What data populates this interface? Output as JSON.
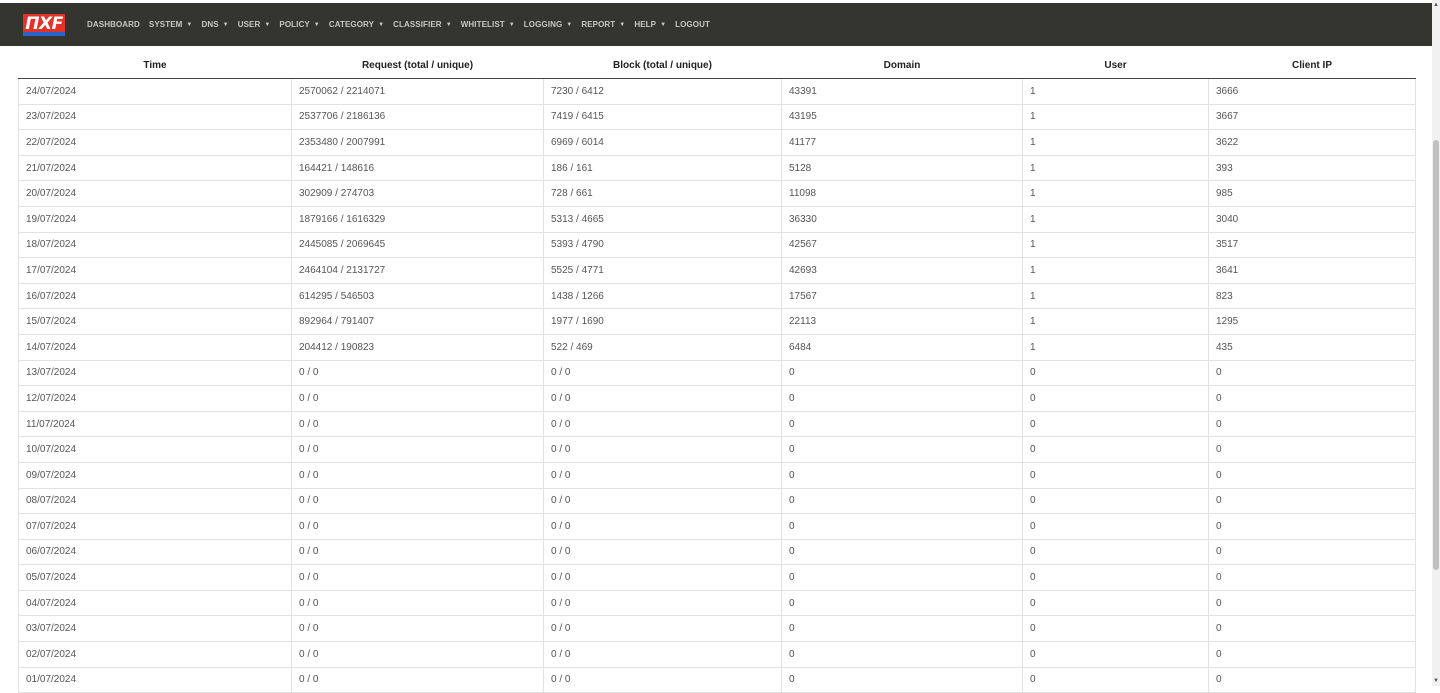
{
  "logo": "ΠXF",
  "nav": [
    {
      "label": "DASHBOARD",
      "caret": false
    },
    {
      "label": "SYSTEM",
      "caret": true
    },
    {
      "label": "DNS",
      "caret": true
    },
    {
      "label": "USER",
      "caret": true
    },
    {
      "label": "POLICY",
      "caret": true
    },
    {
      "label": "CATEGORY",
      "caret": true
    },
    {
      "label": "CLASSIFIER",
      "caret": true
    },
    {
      "label": "WHITELIST",
      "caret": true
    },
    {
      "label": "LOGGING",
      "caret": true
    },
    {
      "label": "REPORT",
      "caret": true
    },
    {
      "label": "HELP",
      "caret": true
    },
    {
      "label": "LOGOUT",
      "caret": false
    }
  ],
  "table": {
    "headers": [
      "Time",
      "Request (total / unique)",
      "Block (total / unique)",
      "Domain",
      "User",
      "Client IP"
    ],
    "rows": [
      [
        "24/07/2024",
        "2570062 / 2214071",
        "7230 / 6412",
        "43391",
        "1",
        "3666"
      ],
      [
        "23/07/2024",
        "2537706 / 2186136",
        "7419 / 6415",
        "43195",
        "1",
        "3667"
      ],
      [
        "22/07/2024",
        "2353480 / 2007991",
        "6969 / 6014",
        "41177",
        "1",
        "3622"
      ],
      [
        "21/07/2024",
        "164421 / 148616",
        "186 / 161",
        "5128",
        "1",
        "393"
      ],
      [
        "20/07/2024",
        "302909 / 274703",
        "728 / 661",
        "11098",
        "1",
        "985"
      ],
      [
        "19/07/2024",
        "1879166 / 1616329",
        "5313 / 4665",
        "36330",
        "1",
        "3040"
      ],
      [
        "18/07/2024",
        "2445085 / 2069645",
        "5393 / 4790",
        "42567",
        "1",
        "3517"
      ],
      [
        "17/07/2024",
        "2464104 / 2131727",
        "5525 / 4771",
        "42693",
        "1",
        "3641"
      ],
      [
        "16/07/2024",
        "614295 / 546503",
        "1438 / 1266",
        "17567",
        "1",
        "823"
      ],
      [
        "15/07/2024",
        "892964 / 791407",
        "1977 / 1690",
        "22113",
        "1",
        "1295"
      ],
      [
        "14/07/2024",
        "204412 / 190823",
        "522 / 469",
        "6484",
        "1",
        "435"
      ],
      [
        "13/07/2024",
        "0 / 0",
        "0 / 0",
        "0",
        "0",
        "0"
      ],
      [
        "12/07/2024",
        "0 / 0",
        "0 / 0",
        "0",
        "0",
        "0"
      ],
      [
        "11/07/2024",
        "0 / 0",
        "0 / 0",
        "0",
        "0",
        "0"
      ],
      [
        "10/07/2024",
        "0 / 0",
        "0 / 0",
        "0",
        "0",
        "0"
      ],
      [
        "09/07/2024",
        "0 / 0",
        "0 / 0",
        "0",
        "0",
        "0"
      ],
      [
        "08/07/2024",
        "0 / 0",
        "0 / 0",
        "0",
        "0",
        "0"
      ],
      [
        "07/07/2024",
        "0 / 0",
        "0 / 0",
        "0",
        "0",
        "0"
      ],
      [
        "06/07/2024",
        "0 / 0",
        "0 / 0",
        "0",
        "0",
        "0"
      ],
      [
        "05/07/2024",
        "0 / 0",
        "0 / 0",
        "0",
        "0",
        "0"
      ],
      [
        "04/07/2024",
        "0 / 0",
        "0 / 0",
        "0",
        "0",
        "0"
      ],
      [
        "03/07/2024",
        "0 / 0",
        "0 / 0",
        "0",
        "0",
        "0"
      ],
      [
        "02/07/2024",
        "0 / 0",
        "0 / 0",
        "0",
        "0",
        "0"
      ],
      [
        "01/07/2024",
        "0 / 0",
        "0 / 0",
        "0",
        "0",
        "0"
      ]
    ]
  },
  "colors": {
    "topbar": "#353530",
    "logo_red": "#e2332a",
    "logo_blue": "#2b63c9",
    "nav_text": "#c7c7c2"
  }
}
